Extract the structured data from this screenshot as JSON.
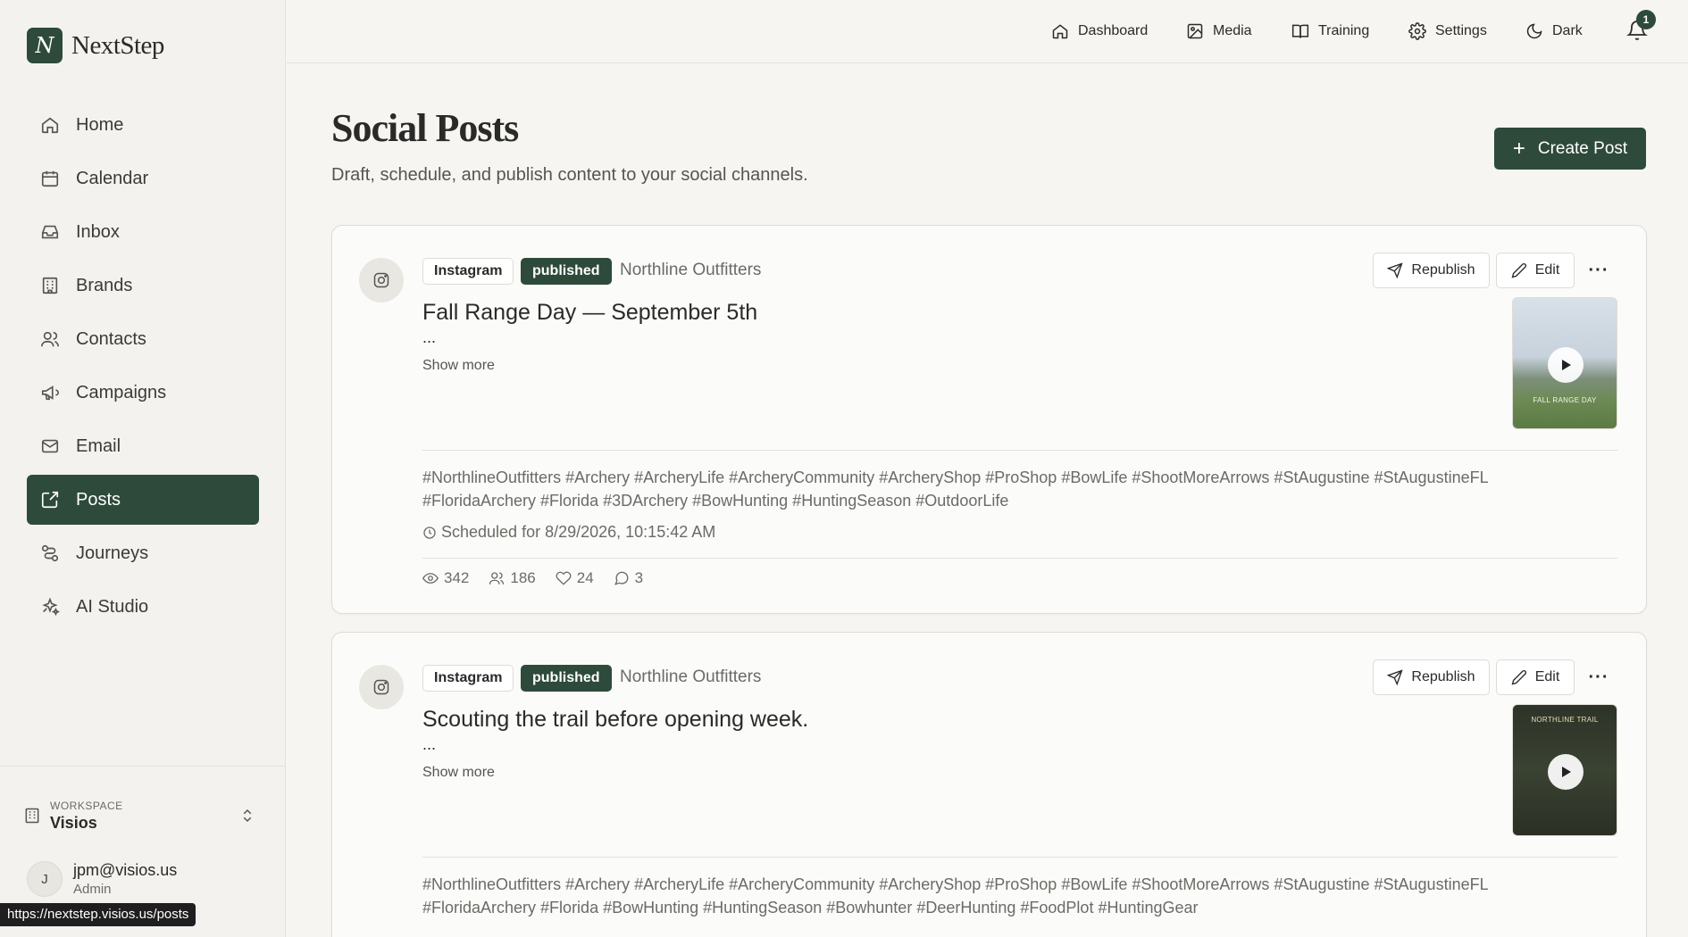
{
  "app": {
    "logo_letter": "N",
    "name": "NextStep"
  },
  "sidebar": {
    "items": [
      {
        "label": "Home",
        "icon": "home-icon"
      },
      {
        "label": "Calendar",
        "icon": "calendar-icon"
      },
      {
        "label": "Inbox",
        "icon": "inbox-icon"
      },
      {
        "label": "Brands",
        "icon": "building-icon"
      },
      {
        "label": "Contacts",
        "icon": "users-icon"
      },
      {
        "label": "Campaigns",
        "icon": "megaphone-icon"
      },
      {
        "label": "Email",
        "icon": "mail-icon"
      },
      {
        "label": "Posts",
        "icon": "share-icon",
        "active": true
      },
      {
        "label": "Journeys",
        "icon": "route-icon"
      },
      {
        "label": "AI Studio",
        "icon": "sparkles-icon"
      }
    ],
    "workspace": {
      "label": "WORKSPACE",
      "name": "Visios"
    },
    "user": {
      "initial": "J",
      "email": "jpm@visios.us",
      "role": "Admin"
    }
  },
  "status_url": "https://nextstep.visios.us/posts",
  "topbar": {
    "dashboard": "Dashboard",
    "media": "Media",
    "training": "Training",
    "settings": "Settings",
    "theme": "Dark",
    "notifications_count": "1"
  },
  "page": {
    "title": "Social Posts",
    "subtitle": "Draft, schedule, and publish content to your social channels.",
    "create_label": "Create Post"
  },
  "posts": [
    {
      "platform": "Instagram",
      "status": "published",
      "brand": "Northline Outfitters",
      "title": "Fall Range Day — September 5th",
      "ellipsis": "...",
      "show_more": "Show more",
      "thumb_caption": "FALL RANGE DAY",
      "hashtags": "#NorthlineOutfitters #Archery #ArcheryLife #ArcheryCommunity #ArcheryShop #ProShop #BowLife #ShootMoreArrows #StAugustine #StAugustineFL #FloridaArchery #Florida #3DArchery #BowHunting #HuntingSeason #OutdoorLife",
      "scheduled": "Scheduled for 8/29/2026, 10:15:42 AM",
      "stats": {
        "views": "342",
        "reach": "186",
        "likes": "24",
        "comments": "3"
      },
      "republish": "Republish",
      "edit": "Edit"
    },
    {
      "platform": "Instagram",
      "status": "published",
      "brand": "Northline Outfitters",
      "title": "Scouting the trail before opening week.",
      "ellipsis": "...",
      "show_more": "Show more",
      "thumb_caption": "NORTHLINE TRAIL",
      "hashtags": "#NorthlineOutfitters #Archery #ArcheryLife #ArcheryCommunity #ArcheryShop #ProShop #BowLife #ShootMoreArrows #StAugustine #StAugustineFL #FloridaArchery #Florida #BowHunting #HuntingSeason #Bowhunter #DeerHunting #FoodPlot #HuntingGear",
      "republish": "Republish",
      "edit": "Edit"
    }
  ],
  "colors": {
    "accent": "#2e4a3b",
    "background": "#f6f5f2",
    "card": "#fbfbf9"
  }
}
